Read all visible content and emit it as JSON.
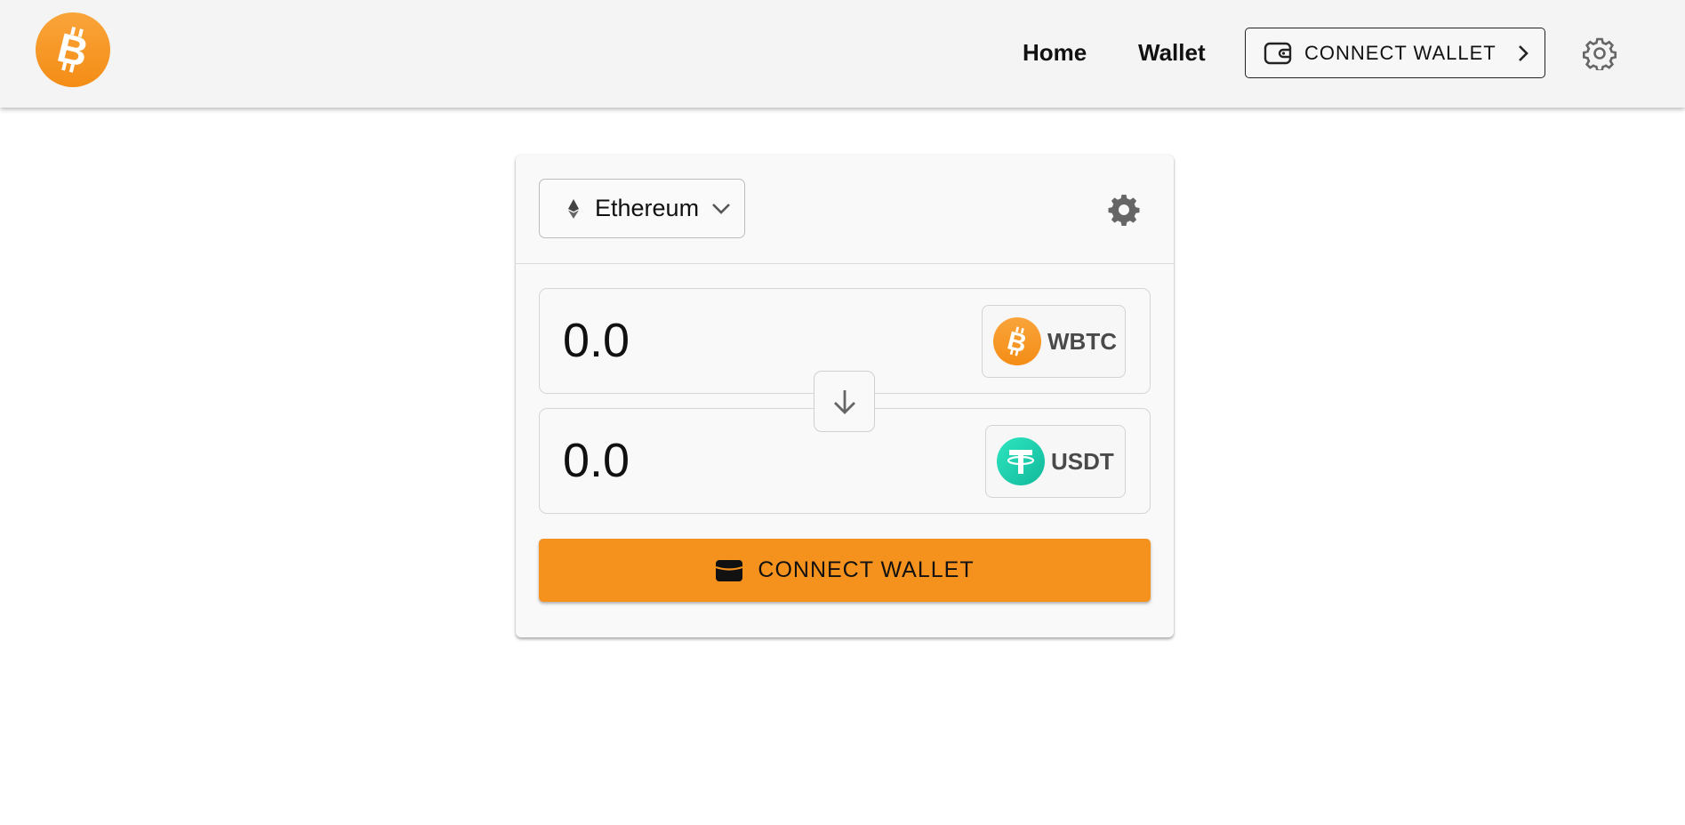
{
  "header": {
    "logo_icon": "bitcoin-logo",
    "nav": [
      {
        "label": "Home"
      },
      {
        "label": "Wallet"
      }
    ],
    "connect_button": {
      "label": "CONNECT WALLET",
      "icon": "wallet-icon",
      "trailing_icon": "chevron-right-icon"
    },
    "settings_icon": "gear-icon"
  },
  "swap": {
    "network": {
      "label": "Ethereum",
      "icon": "ethereum-icon"
    },
    "settings_icon": "gear-icon",
    "from": {
      "value": "0.0",
      "token": "WBTC",
      "token_icon": "bitcoin-icon",
      "token_color": "#f7931a"
    },
    "to": {
      "value": "0.0",
      "token": "USDT",
      "token_icon": "tether-icon",
      "token_color": "#26d6b4"
    },
    "switch_icon": "arrow-down-icon",
    "connect_button": {
      "label": "CONNECT WALLET",
      "icon": "wallet-icon"
    }
  },
  "colors": {
    "accent": "#f5921e",
    "topbar_bg": "#f4f4f4",
    "card_bg": "#f9f9f9"
  }
}
